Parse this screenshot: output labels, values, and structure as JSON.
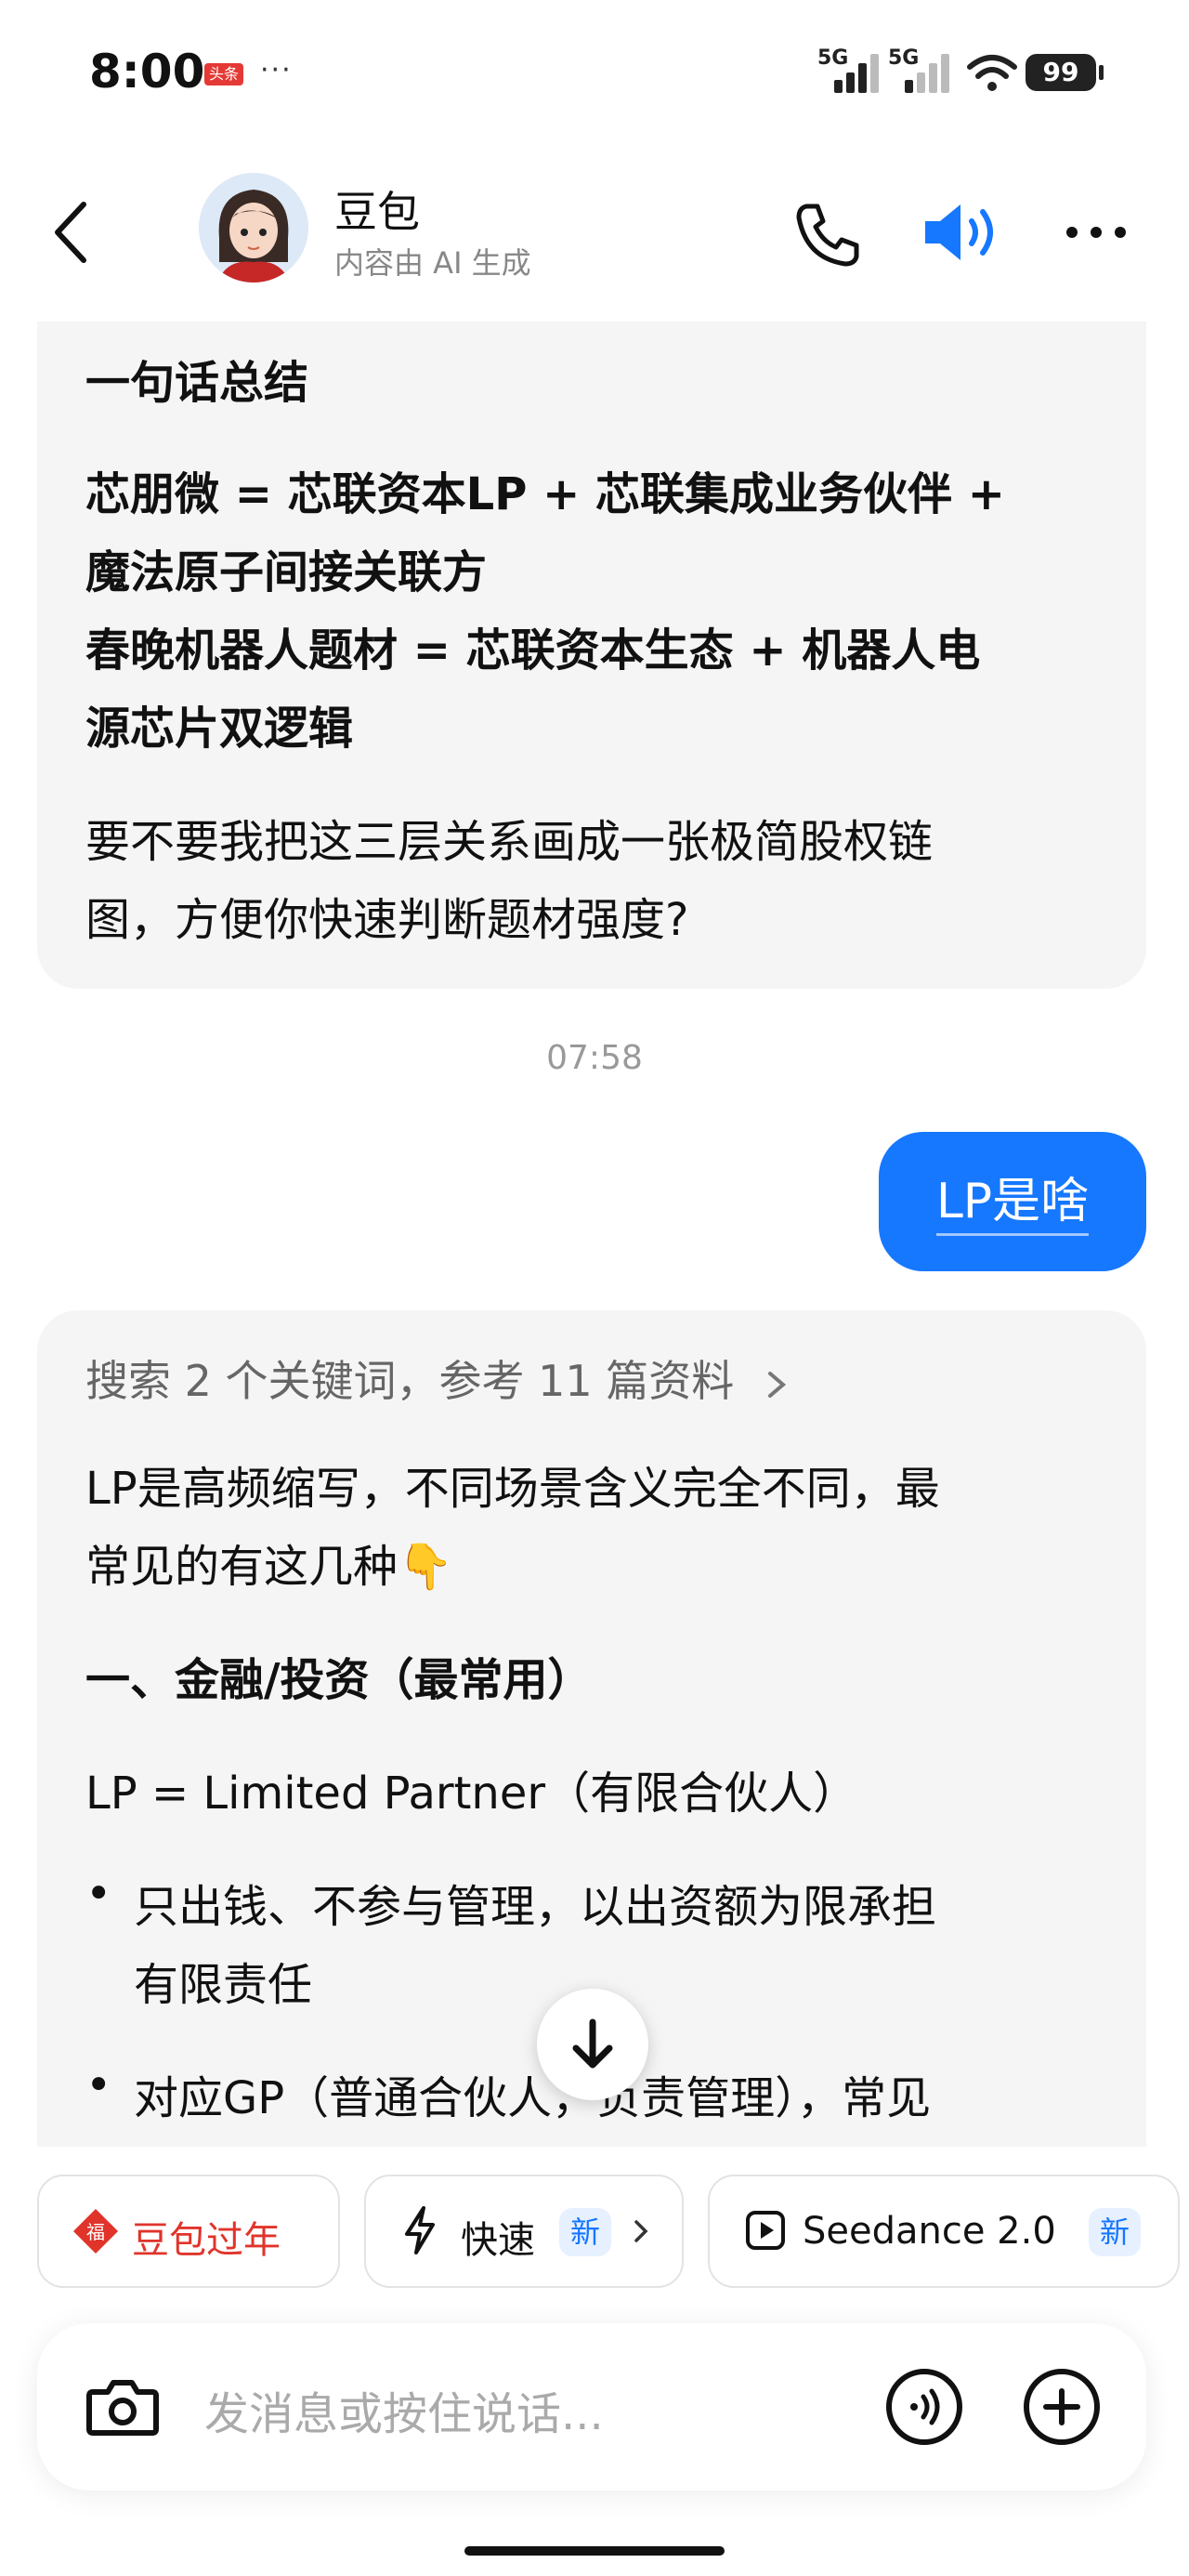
{
  "status_bar": {
    "time": "8:00",
    "news_badge": "头条",
    "more": "···",
    "signal1": "5G",
    "signal2": "5G",
    "battery": "99"
  },
  "header": {
    "name": "豆包",
    "subtitle": "内容由 AI 生成"
  },
  "message_prev": {
    "summary_title": "一句话总结",
    "line1": "芯朋微 = 芯联资本LP + 芯联集成业务伙伴 +",
    "line2": "魔法原子间接关联方",
    "line3": "春晚机器人题材 = 芯联资本生态 + 机器人电",
    "line4": "源芯片双逻辑",
    "question1": "要不要我把这三层关系画成一张极简股权链",
    "question2": "图，方便你快速判断题材强度?"
  },
  "timestamp": "07:58",
  "user_message": "LP是啥",
  "message_current": {
    "search_info": "搜索 2 个关键词，参考 11 篇资料",
    "intro1": "LP是高频缩写，不同场景含义完全不同，最",
    "intro2": "常见的有这几种👇",
    "section_title": "一、金融/投资（最常用）",
    "definition": "LP = Limited Partner（有限合伙人）",
    "bullet1_line1": "只出钱、不参与管理，以出资额为限承担",
    "bullet1_line2": "有限责任",
    "bullet2_line1": "对应GP（普通合伙人，负责管理），常见"
  },
  "chips": [
    {
      "label": "豆包过年",
      "icon": "fu-icon"
    },
    {
      "label": "快速",
      "tag": "新",
      "icon": "lightning-icon"
    },
    {
      "label": "Seedance 2.0",
      "tag": "新",
      "icon": "video-icon"
    }
  ],
  "input": {
    "placeholder": "发消息或按住说话..."
  },
  "colors": {
    "accent": "#1677ff",
    "bubble_ai": "#f5f5f5",
    "chip_red": "#e0342b"
  }
}
